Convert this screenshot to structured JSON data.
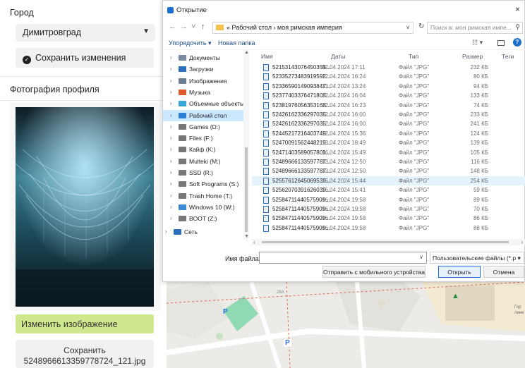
{
  "settings": {
    "city_label": "Город",
    "city_value": "Димитровград",
    "save_changes": "Сохранить изменения",
    "photo_label": "Фотография профиля",
    "change_image": "Изменить изображение",
    "save_line1": "Сохранить",
    "save_line2": "5248966613359778724_121.jpg"
  },
  "map": {
    "label_a": "28А",
    "label_b": "Гор",
    "label_c": "лине",
    "parking": "P"
  },
  "dialog": {
    "title": "Открытие",
    "close": "×",
    "address": "« Рабочий стол › моя римская империя",
    "search_placeholder": "Поиск в: моя римская импе...",
    "organize": "Упорядочить ▾",
    "new_folder": "Новая папка",
    "columns": {
      "name": "Имя",
      "date": "Даты",
      "type": "Тип",
      "size": "Размер",
      "tags": "Теги"
    },
    "tree": [
      {
        "label": "Документы",
        "icon": "documents-icon",
        "color": "#7a8aa0"
      },
      {
        "label": "Загрузки",
        "icon": "downloads-icon",
        "color": "#2d6fbf"
      },
      {
        "label": "Изображения",
        "icon": "pictures-icon",
        "color": "#6b7d92"
      },
      {
        "label": "Музыка",
        "icon": "music-icon",
        "color": "#e0572c"
      },
      {
        "label": "Объемные объекты",
        "icon": "3d-objects-icon",
        "color": "#3aa3d8"
      },
      {
        "label": "Рабочий стол",
        "icon": "desktop-icon",
        "color": "#2d7fd6"
      },
      {
        "label": "Games (D:)",
        "icon": "drive-icon",
        "color": "#777"
      },
      {
        "label": "Files (F:)",
        "icon": "drive-icon",
        "color": "#777"
      },
      {
        "label": "Кайф (K:)",
        "icon": "drive-icon",
        "color": "#777"
      },
      {
        "label": "Multeki (M:)",
        "icon": "drive-icon",
        "color": "#777"
      },
      {
        "label": "SSD (R:)",
        "icon": "drive-icon",
        "color": "#777"
      },
      {
        "label": "Soft Programs (S:)",
        "icon": "drive-icon",
        "color": "#777"
      },
      {
        "label": "Trash Home (T:)",
        "icon": "drive-icon",
        "color": "#777"
      },
      {
        "label": "Windows 10 (W:)",
        "icon": "windows-drive-icon",
        "color": "#3b8ad6"
      },
      {
        "label": "BOOT (Z:)",
        "icon": "drive-icon",
        "color": "#777"
      },
      {
        "label": "Сеть",
        "icon": "network-icon",
        "color": "#2d6fbf"
      }
    ],
    "files": [
      {
        "name": "52153143076450359...",
        "date": "02.04.2024 17:11",
        "type": "Файл \"JPG\"",
        "size": "232 КБ"
      },
      {
        "name": "52335273483919592...",
        "date": "12.04.2024 16:24",
        "type": "Файл \"JPG\"",
        "size": "80 КБ"
      },
      {
        "name": "52336590149093847...",
        "date": "13.04.2024 13:24",
        "type": "Файл \"JPG\"",
        "size": "94 КБ"
      },
      {
        "name": "52377403376471803...",
        "date": "12.04.2024 16:04",
        "type": "Файл \"JPG\"",
        "size": "133 КБ"
      },
      {
        "name": "52381976056353168...",
        "date": "12.04.2024 16:23",
        "type": "Файл \"JPG\"",
        "size": "74 КБ"
      },
      {
        "name": "52426162336297035...",
        "date": "12.04.2024 16:00",
        "type": "Файл \"JPG\"",
        "size": "233 КБ"
      },
      {
        "name": "52426162336297035...",
        "date": "12.04.2024 16:00",
        "type": "Файл \"JPG\"",
        "size": "241 КБ"
      },
      {
        "name": "52445217216403749...",
        "date": "12.04.2024 15:36",
        "type": "Файл \"JPG\"",
        "size": "124 КБ"
      },
      {
        "name": "52470091562448219...",
        "date": "13.04.2024 18:49",
        "type": "Файл \"JPG\"",
        "size": "139 КБ"
      },
      {
        "name": "52471403589057801...",
        "date": "16.04.2024 15:49",
        "type": "Файл \"JPG\"",
        "size": "105 КБ"
      },
      {
        "name": "52489666133597787...",
        "date": "13.04.2024 12:50",
        "type": "Файл \"JPG\"",
        "size": "116 КБ"
      },
      {
        "name": "52489666133597787...",
        "date": "13.04.2024 12:50",
        "type": "Файл \"JPG\"",
        "size": "148 КБ"
      },
      {
        "name": "52557612645069532...",
        "date": "16.04.2024 15:44",
        "type": "Файл \"JPG\"",
        "size": "254 КБ"
      },
      {
        "name": "52562070391626039...",
        "date": "16.04.2024 15:41",
        "type": "Файл \"JPG\"",
        "size": "59 КБ"
      },
      {
        "name": "52584711440575909...",
        "date": "16.04.2024 19:58",
        "type": "Файл \"JPG\"",
        "size": "89 КБ"
      },
      {
        "name": "52584711440575909...",
        "date": "16.04.2024 19:58",
        "type": "Файл \"JPG\"",
        "size": "70 КБ"
      },
      {
        "name": "52584711440575909...",
        "date": "16.04.2024 19:58",
        "type": "Файл \"JPG\"",
        "size": "86 КБ"
      },
      {
        "name": "52584711440575909...",
        "date": "16.04.2024 19:58",
        "type": "Файл \"JPG\"",
        "size": "88 КБ"
      }
    ],
    "selected_file_index": 12,
    "selected_tree_index": 5,
    "filename_label": "Имя файла:",
    "filename_value": "",
    "filter": "Пользовательские файлы (*.p ▾",
    "send_mobile": "Отправить с мобильного устройства",
    "open": "Открыть",
    "cancel": "Отмена"
  }
}
